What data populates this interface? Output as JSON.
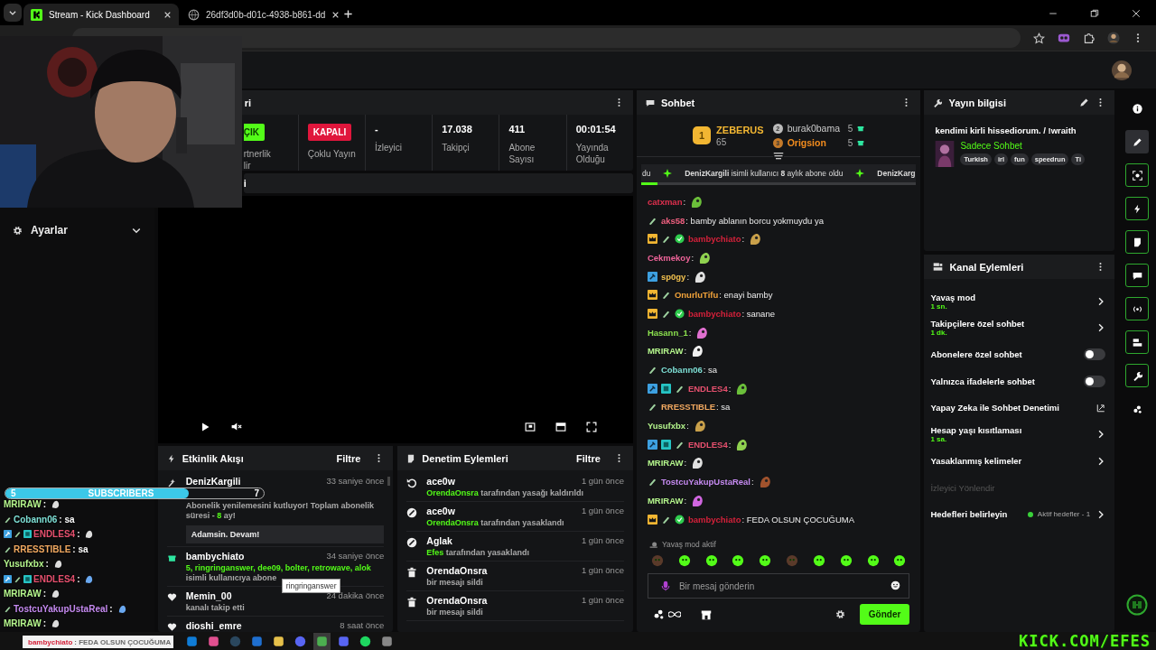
{
  "browser": {
    "tabs": [
      {
        "title": "Stream - Kick Dashboard",
        "selected": true
      },
      {
        "title": "26df3d0b-d01c-4938-b861-dd",
        "selected": false
      }
    ]
  },
  "sidebar": {
    "item": "Ayarlar"
  },
  "stream_panel": {
    "title": "ri",
    "stats": [
      {
        "kind": "status",
        "badge": "ÇIK",
        "on": true,
        "label": "rtnerlik\nlir"
      },
      {
        "kind": "status",
        "badge": "KAPALI",
        "on": false,
        "label": "Çoklu Yayın"
      },
      {
        "kind": "number",
        "value": "-",
        "label": "İzleyici"
      },
      {
        "kind": "number",
        "value": "17.038",
        "label": "Takipçi"
      },
      {
        "kind": "number",
        "value": "411",
        "label": "Abone Sayısı"
      },
      {
        "kind": "number",
        "value": "00:01:54",
        "label": "Yayında Olduğu"
      }
    ]
  },
  "collapsed_panel": {
    "title": "i"
  },
  "activity": {
    "title": "Etkinlik Akışı",
    "filter": "Filtre",
    "items": [
      {
        "kind": "sub",
        "user": "DenizKargili",
        "time": "33 saniye önce",
        "parts": [
          {
            "text": "Abonelik yenilemesini kutluyor! Toplam abonelik süresi - ",
            "accent": false
          },
          {
            "text": "8",
            "accent": true
          },
          {
            "text": " ay!",
            "accent": false
          }
        ],
        "note": "Adamsin. Devam!"
      },
      {
        "kind": "gift",
        "user": "bambychiato",
        "time": "34 saniye önce",
        "parts": [
          {
            "text": "5, ringringanswer, dee09, bolter, retrowave, alok",
            "accent": true
          },
          {
            "text": " isimli kullanıcıya abone",
            "accent": false
          }
        ],
        "tooltip": "ringringanswer"
      },
      {
        "kind": "follow",
        "user": "Memin_00",
        "time": "24 dakika önce",
        "parts": [
          {
            "text": "kanalı takip etti",
            "accent": false
          }
        ]
      },
      {
        "kind": "follow",
        "user": "dioshi_emre",
        "time": "8 saat önce"
      }
    ]
  },
  "moderation": {
    "title": "Denetim Eylemleri",
    "filter": "Filtre",
    "items": [
      {
        "kind": "unban",
        "user": "ace0w",
        "time": "1 gün önce",
        "parts": [
          {
            "text": "OrendaOnsra",
            "accent": true
          },
          {
            "text": " tarafından yasağı kaldırıldı",
            "accent": false
          }
        ]
      },
      {
        "kind": "ban",
        "user": "ace0w",
        "time": "1 gün önce",
        "parts": [
          {
            "text": "OrendaOnsra",
            "accent": true
          },
          {
            "text": " tarafından yasaklandı",
            "accent": false
          }
        ]
      },
      {
        "kind": "ban",
        "user": "Aglak",
        "time": "1 gün önce",
        "parts": [
          {
            "text": "Efes",
            "accent": true
          },
          {
            "text": " tarafından yasaklandı",
            "accent": false
          }
        ]
      },
      {
        "kind": "delete",
        "user": "OrendaOnsra",
        "time": "1 gün önce",
        "parts": [
          {
            "text": "bir mesajı sildi",
            "accent": false
          }
        ]
      },
      {
        "kind": "delete",
        "user": "OrendaOnsra",
        "time": "1 gün önce",
        "parts": [
          {
            "text": "bir mesajı sildi",
            "accent": false
          }
        ]
      }
    ]
  },
  "chat": {
    "title": "Sohbet",
    "leaders": [
      {
        "rank": "1",
        "user": "ZEBERUS",
        "count": "65"
      },
      {
        "rank": "2",
        "user": "burak0bama",
        "count": "5"
      },
      {
        "rank": "3",
        "user": "Origsion",
        "count": "5"
      }
    ],
    "pinned": {
      "lead": "du",
      "text": "**DenizKargili** isimli kullanıcı **8** aylık abone oldu",
      "tail": "DenizKarg",
      "level": 0.06
    },
    "messages": [
      {
        "user": "catxman",
        "color": "#e0304e",
        "text": ":",
        "emote": true
      },
      {
        "user": "aks58",
        "color": "#f06080",
        "badges": [
          {
            "kind": "sub"
          }
        ],
        "text": ": bamby ablanın borcu yokmuydu ya",
        "emote": false
      },
      {
        "user": "bambychiato",
        "color": "#d4213a",
        "badges": [
          {
            "kind": "crown"
          },
          {
            "kind": "sub"
          },
          {
            "kind": "verified"
          }
        ],
        "text": ":",
        "emote": true
      },
      {
        "user": "Cekmekoy",
        "color": "#f0649a",
        "text": ":",
        "emote": true
      },
      {
        "user": "sp0gy",
        "color": "#f2c14e",
        "badges": [
          {
            "kind": "mod"
          }
        ],
        "text": ":",
        "emote": true
      },
      {
        "user": "OnurluTifu",
        "color": "#f2a33a",
        "badges": [
          {
            "kind": "crown"
          },
          {
            "kind": "sub"
          }
        ],
        "text": ": enayi bamby",
        "emote": false
      },
      {
        "user": "bambychiato",
        "color": "#d4213a",
        "badges": [
          {
            "kind": "crown"
          },
          {
            "kind": "sub"
          },
          {
            "kind": "verified"
          }
        ],
        "text": ": sanane",
        "emote": false
      },
      {
        "user": "Hasann_1",
        "color": "#8be04e",
        "text": ":",
        "emote": true
      },
      {
        "user": "MRIRAW",
        "color": "#b4f58c",
        "text": ":",
        "emote": true
      },
      {
        "user": "Cobann06",
        "color": "#7ee0d6",
        "badges": [
          {
            "kind": "sub"
          }
        ],
        "text": ": sa",
        "emote": false
      },
      {
        "user": "ENDLES4",
        "color": "#e6506e",
        "badges": [
          {
            "kind": "mod"
          },
          {
            "kind": "og"
          },
          {
            "kind": "sub"
          }
        ],
        "text": ":",
        "emote": true
      },
      {
        "user": "RRESSTIBLE",
        "color": "#f0a860",
        "badges": [
          {
            "kind": "sub"
          }
        ],
        "text": ": sa",
        "emote": false
      },
      {
        "user": "Yusufxbx",
        "color": "#b4f58c",
        "text": ":",
        "emote": true
      },
      {
        "user": "ENDLES4",
        "color": "#e6506e",
        "badges": [
          {
            "kind": "mod"
          },
          {
            "kind": "og"
          },
          {
            "kind": "sub"
          }
        ],
        "text": ":",
        "emote": true
      },
      {
        "user": "MRIRAW",
        "color": "#b4f58c",
        "text": ":",
        "emote": true
      },
      {
        "user": "TostcuYakupUstaReal",
        "color": "#c58af0",
        "badges": [
          {
            "kind": "sub"
          }
        ],
        "text": ":",
        "emote": true
      },
      {
        "user": "MRIRAW",
        "color": "#b4f58c",
        "text": ":",
        "emote": true
      },
      {
        "user": "bambychiato",
        "color": "#d4213a",
        "badges": [
          {
            "kind": "crown"
          },
          {
            "kind": "sub"
          },
          {
            "kind": "verified"
          }
        ],
        "text": ": FEDA OLSUN ÇOCUĞUMA",
        "emote": false
      }
    ],
    "slow_mode": "Yavaş mod aktif",
    "placeholder": "Bir mesaj gönderin",
    "send": "Gönder"
  },
  "stream_info": {
    "title": "Yayın bilgisi",
    "stream_title": "kendimi kirli hissediorum. / !wraith",
    "category": "Sadece Sohbet",
    "tags": [
      "Turkish",
      "irl",
      "fun",
      "speedrun",
      "Ti"
    ]
  },
  "channel_actions": {
    "title": "Kanal Eylemleri",
    "items": [
      {
        "kind": "link",
        "label": "Yavaş mod",
        "value": "1 sn."
      },
      {
        "kind": "link",
        "label": "Takipçilere özel sohbet",
        "value": "1 dk."
      },
      {
        "kind": "toggle",
        "label": "Abonelere özel sohbet",
        "on": false
      },
      {
        "kind": "toggle",
        "label": "Yalnızca ifadelerle sohbet",
        "on": false
      },
      {
        "kind": "external",
        "label": "Yapay Zeka ile Sohbet Denetimi"
      },
      {
        "kind": "link",
        "label": "Hesap yaşı kısıtlaması",
        "value": "1 sa."
      },
      {
        "kind": "link",
        "label": "Yasaklanmış kelimeler"
      },
      {
        "kind": "section",
        "label": "İzleyici Yönlendir"
      },
      {
        "kind": "goal",
        "label": "Hedefleri belirleyin",
        "status": "Aktif hedefler - 1"
      }
    ]
  },
  "rail": [
    {
      "kind": "info",
      "selected": false,
      "active": false
    },
    {
      "kind": "edit",
      "selected": true,
      "active": false
    },
    {
      "kind": "focus",
      "selected": false,
      "active": true
    },
    {
      "kind": "bolt",
      "selected": false,
      "active": true
    },
    {
      "kind": "note",
      "selected": false,
      "active": true
    },
    {
      "kind": "chat",
      "selected": false,
      "active": true
    },
    {
      "kind": "broadcast",
      "selected": false,
      "active": true
    },
    {
      "kind": "card",
      "selected": false,
      "active": true
    },
    {
      "kind": "wrench",
      "selected": false,
      "active": true
    },
    {
      "kind": "dots",
      "selected": false,
      "active": false
    }
  ],
  "stream_overlay": {
    "goal": {
      "count": "5",
      "label": "SUBSCRIBERS",
      "target": "7",
      "level": 0.71
    },
    "chat": [
      {
        "user": "MRIRAW",
        "color": "#b4f58c",
        "text": " :",
        "emote": true
      },
      {
        "user": "Cobann06",
        "color": "#7ee0d6",
        "badges": [
          {
            "kind": "sub"
          }
        ],
        "text": " : sa",
        "emote": false
      },
      {
        "user": "ENDLES4",
        "color": "#e6506e",
        "badges": [
          {
            "kind": "mod"
          },
          {
            "kind": "sub"
          },
          {
            "kind": "og"
          }
        ],
        "text": " :",
        "emote": true
      },
      {
        "user": "RRESSTIBLE",
        "color": "#f0a860",
        "badges": [
          {
            "kind": "sub"
          }
        ],
        "text": " : sa",
        "emote": false
      },
      {
        "user": "Yusufxbx",
        "color": "#b4f58c",
        "text": " :",
        "emote": true
      },
      {
        "user": "ENDLES4",
        "color": "#e6506e",
        "badges": [
          {
            "kind": "mod"
          },
          {
            "kind": "sub"
          },
          {
            "kind": "og"
          }
        ],
        "text": " :",
        "emote": true
      },
      {
        "user": "MRIRAW",
        "color": "#b4f58c",
        "text": " :",
        "emote": true
      },
      {
        "user": "TostcuYakupUstaReal",
        "color": "#c58af0",
        "badges": [
          {
            "kind": "sub"
          }
        ],
        "text": " :",
        "emote": true
      },
      {
        "user": "MRIRAW",
        "color": "#b4f58c",
        "text": " :",
        "emote": true
      }
    ],
    "banner": {
      "user": "bambychiato",
      "color": "#d4213a",
      "text": " : FEDA OLSUN ÇOCUĞUMA"
    },
    "brand": "KICK.COM/EFES"
  }
}
